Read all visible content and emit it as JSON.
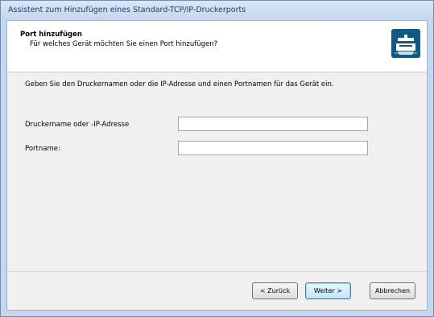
{
  "window": {
    "title": "Assistent zum Hinzufügen eines Standard-TCP/IP-Druckerports"
  },
  "header": {
    "title": "Port hinzufügen",
    "subtitle": "Für welches Gerät möchten Sie einen Port hinzufügen?",
    "icon": "printer-port-wizard-icon"
  },
  "body": {
    "instruction": "Geben Sie den Druckernamen oder die IP-Adresse und einen Portnamen für das Gerät ein.",
    "fields": [
      {
        "label": "Druckername oder -IP-Adresse",
        "value": "",
        "placeholder": ""
      },
      {
        "label": "Portname:",
        "value": "",
        "placeholder": ""
      }
    ]
  },
  "footer": {
    "back_label": "< Zurück",
    "next_label": "Weiter >",
    "cancel_label": "Abbrechen"
  }
}
